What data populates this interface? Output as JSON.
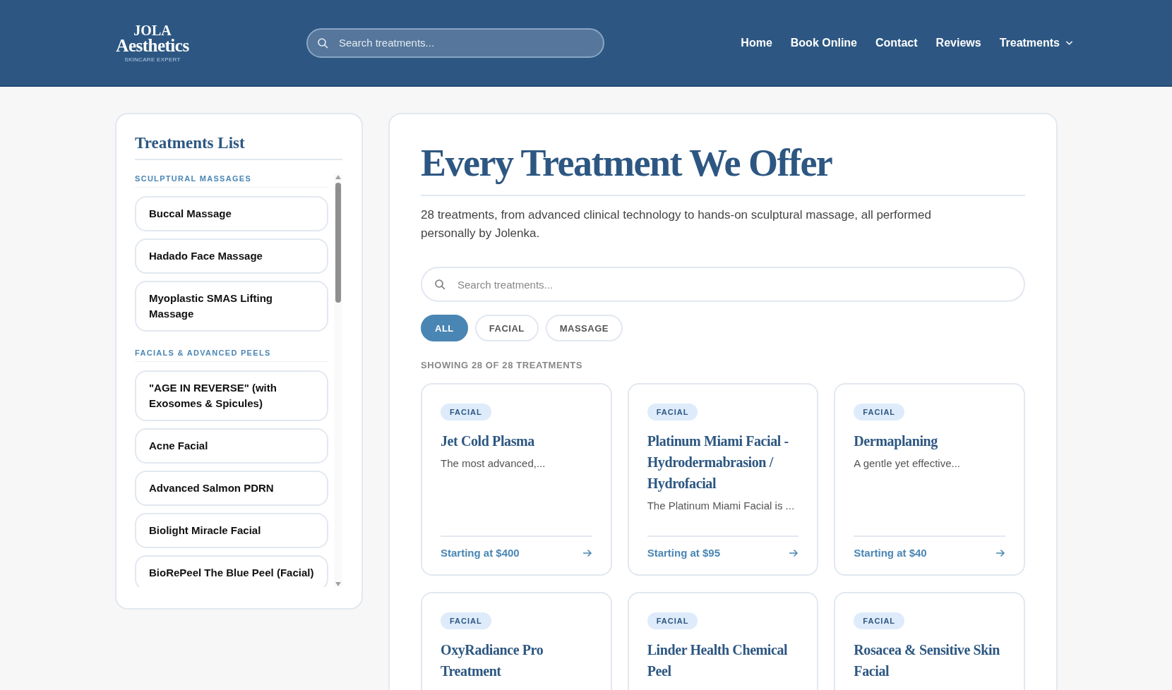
{
  "header": {
    "logo": {
      "line1": "JOLA",
      "line2": "Aesthetics",
      "tagline": "SKINCARE EXPERT"
    },
    "search": {
      "placeholder": "Search treatments..."
    },
    "nav": [
      {
        "label": "Home",
        "dropdown": false
      },
      {
        "label": "Book Online",
        "dropdown": false
      },
      {
        "label": "Contact",
        "dropdown": false
      },
      {
        "label": "Reviews",
        "dropdown": false
      },
      {
        "label": "Treatments",
        "dropdown": true
      }
    ]
  },
  "sidebar": {
    "title": "Treatments List",
    "groups": [
      {
        "heading": "SCULPTURAL MASSAGES",
        "items": [
          "Buccal Massage",
          "Hadado Face Massage",
          "Myoplastic SMAS Lifting Massage"
        ]
      },
      {
        "heading": "FACIALS & ADVANCED PEELS",
        "items": [
          "\"AGE IN REVERSE\" (with Exosomes & Spicules)",
          "Acne Facial",
          "Advanced Salmon PDRN",
          "Biolight Miracle Facial",
          "BioRePeel The Blue Peel (Facial)"
        ]
      }
    ]
  },
  "main": {
    "title": "Every Treatment We Offer",
    "intro": "28 treatments, from advanced clinical technology to hands-on sculptural massage, all performed personally by Jolenka.",
    "search": {
      "placeholder": "Search treatments..."
    },
    "filters": [
      {
        "label": "ALL",
        "selected": true
      },
      {
        "label": "FACIAL",
        "selected": false
      },
      {
        "label": "MASSAGE",
        "selected": false
      }
    ],
    "count": "SHOWING 28 OF 28 TREATMENTS",
    "cards": [
      {
        "tag": "FACIAL",
        "title": "Jet Cold Plasma",
        "description": "The most advanced,...",
        "price": "Starting at $400"
      },
      {
        "tag": "FACIAL",
        "title": "Platinum Miami Facial - Hydrodermabrasion / Hydrofacial",
        "description": "The Platinum Miami Facial is ...",
        "price": "Starting at $95"
      },
      {
        "tag": "FACIAL",
        "title": "Dermaplaning",
        "description": "A gentle yet effective...",
        "price": "Starting at $40"
      },
      {
        "tag": "FACIAL",
        "title": "OxyRadiance Pro Treatment"
      },
      {
        "tag": "FACIAL",
        "title": "Linder Health Chemical Peel"
      },
      {
        "tag": "FACIAL",
        "title": "Rosacea & Sensitive Skin Facial"
      }
    ]
  }
}
